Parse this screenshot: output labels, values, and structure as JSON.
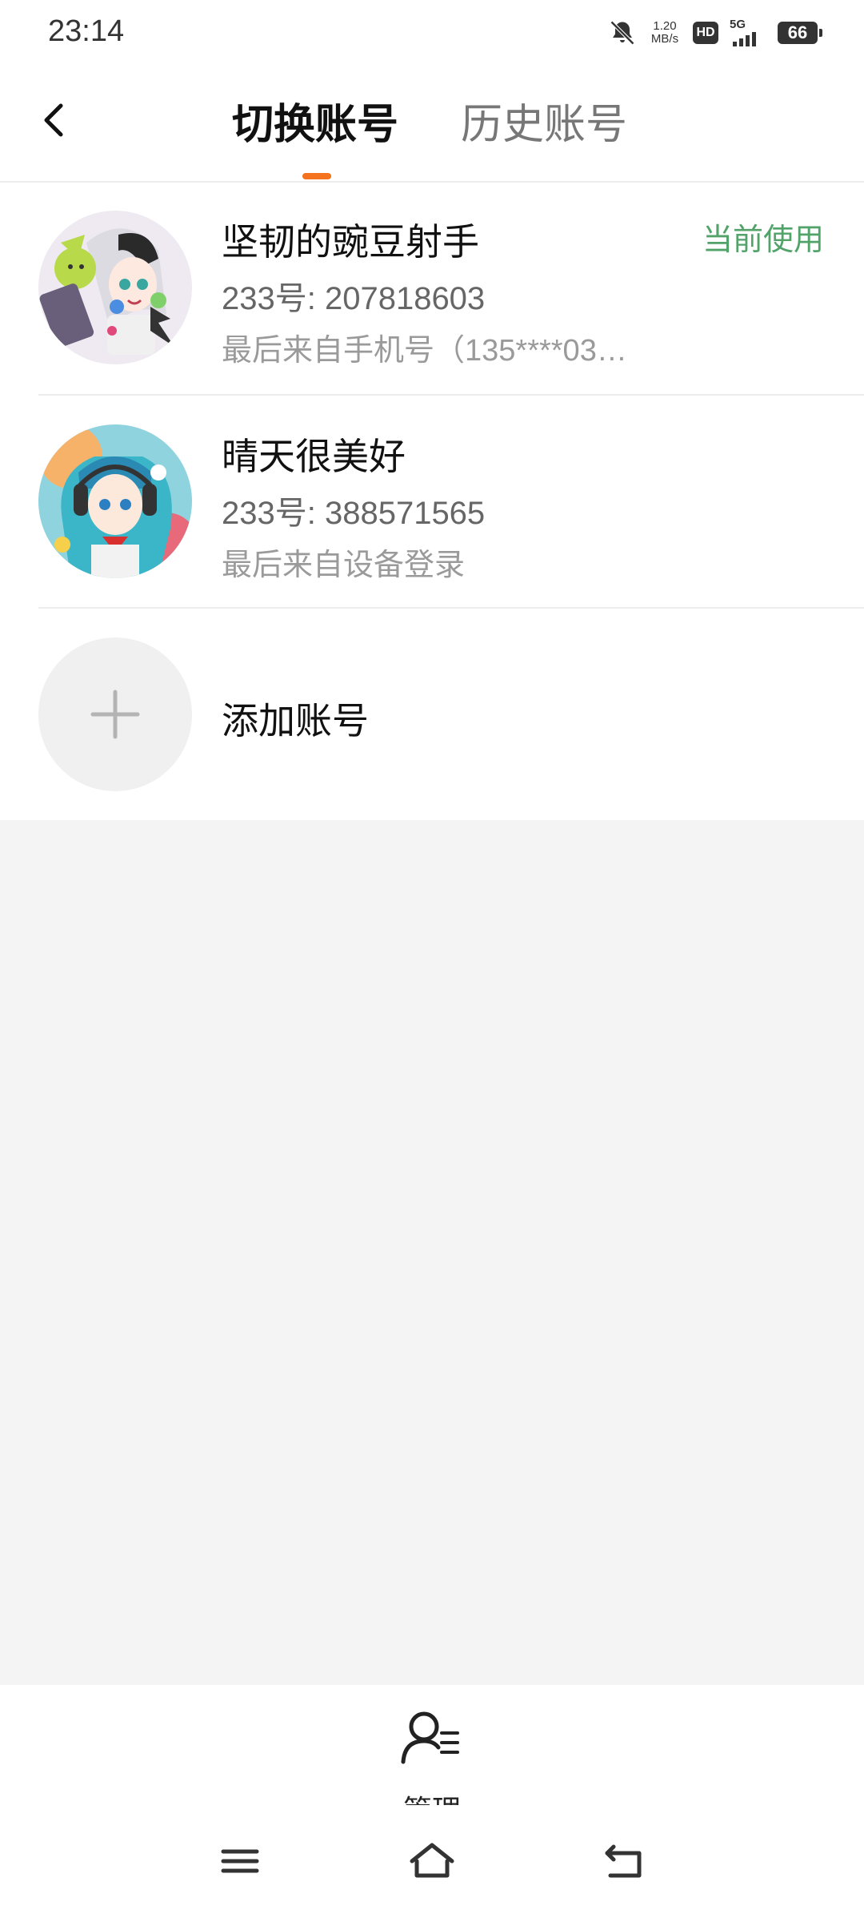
{
  "status_bar": {
    "time": "23:14",
    "net_speed_value": "1.20",
    "net_speed_unit": "MB/s",
    "hd_label": "HD",
    "network_label": "5G",
    "battery": "66"
  },
  "header": {
    "tabs": [
      {
        "label": "切换账号",
        "active": true
      },
      {
        "label": "历史账号",
        "active": false
      }
    ],
    "accent_color": "#f5731e"
  },
  "accounts": [
    {
      "name": "坚韧的豌豆射手",
      "uid": "233号: 207818603",
      "last_login": "最后来自手机号（135****03…",
      "status": "当前使用",
      "avatar_icon": "anime-girl-avatar"
    },
    {
      "name": "晴天很美好",
      "uid": "233号: 388571565",
      "last_login": "最后来自设备登录",
      "status": "",
      "avatar_icon": "anime-girl-headphones-avatar"
    }
  ],
  "add_account": {
    "label": "添加账号",
    "icon": "plus-icon"
  },
  "bottom_action": {
    "label": "管理",
    "icon": "user-manage-icon"
  },
  "colors": {
    "current_status": "#52a36a",
    "background_gray": "#f4f4f4"
  }
}
